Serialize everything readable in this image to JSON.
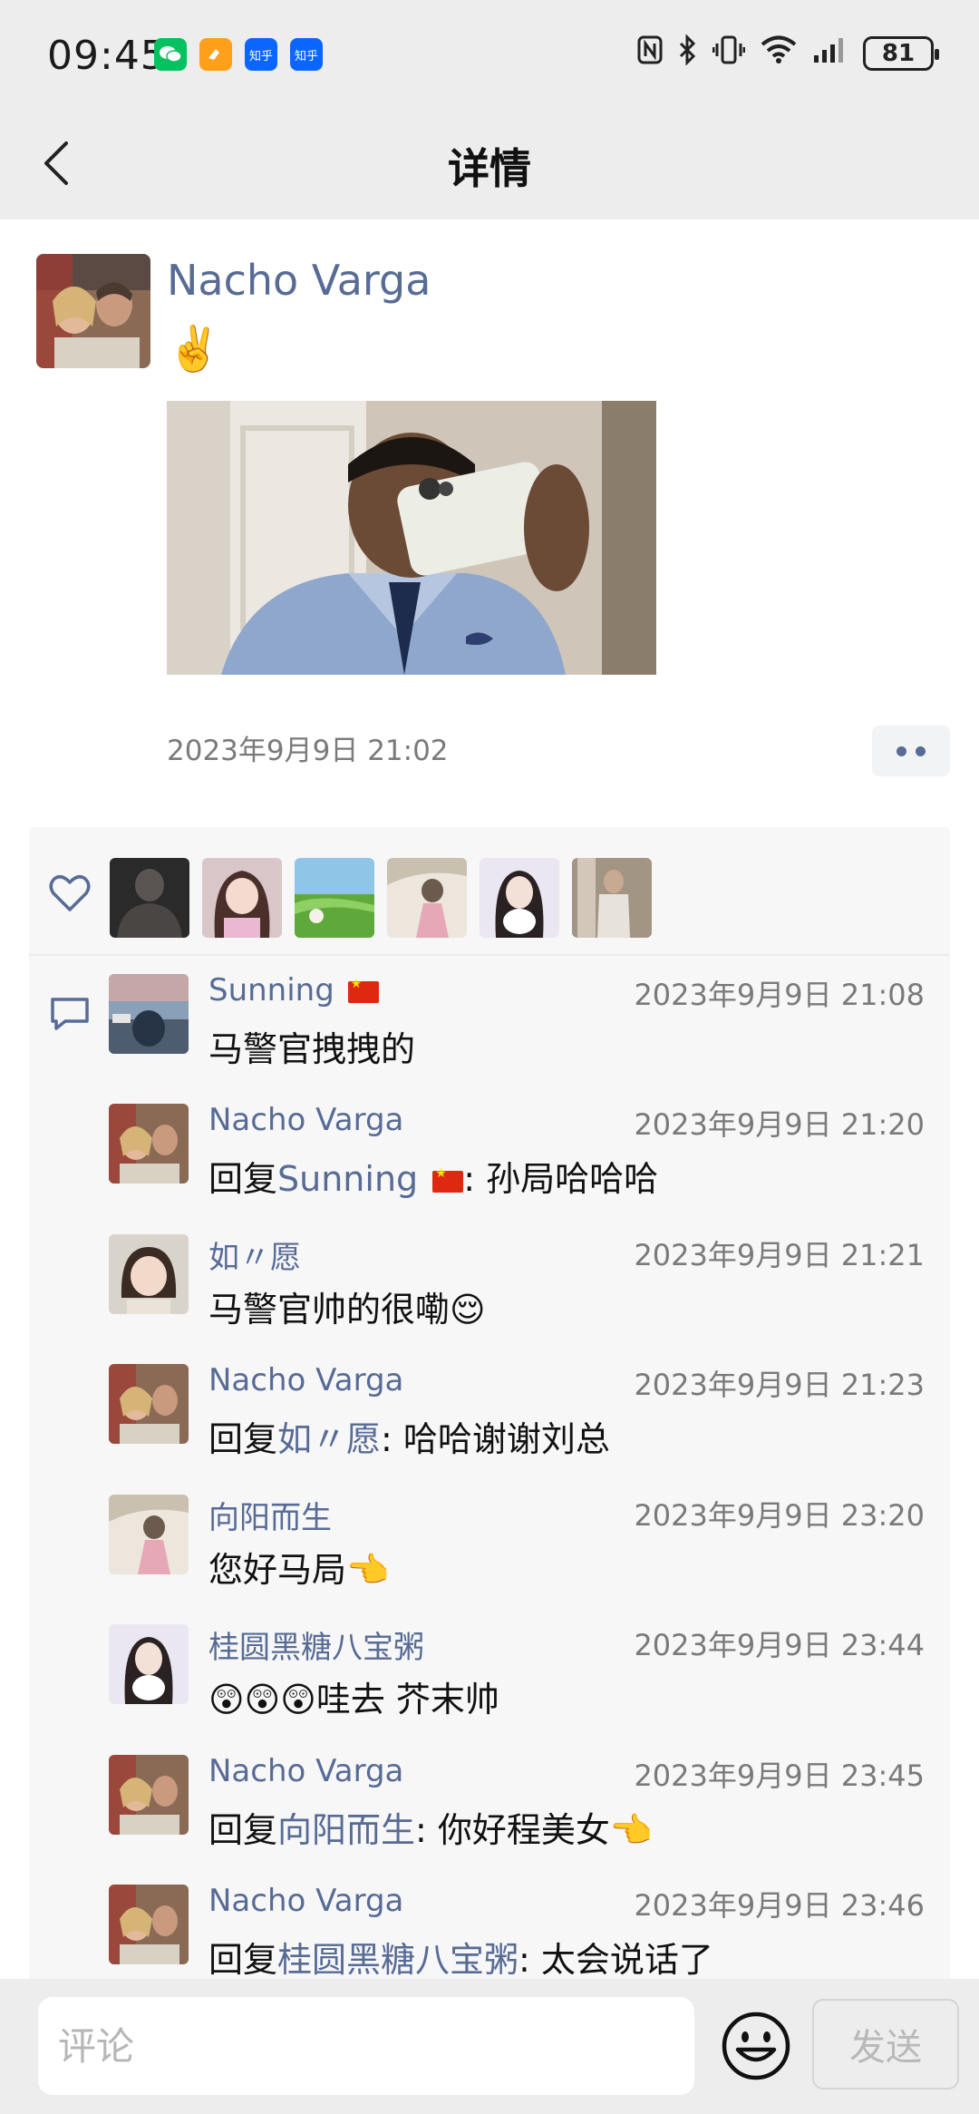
{
  "status_bar": {
    "time": "09:45",
    "apps": [
      "wechat",
      "orange-app",
      "知乎",
      "知乎"
    ],
    "battery": "81"
  },
  "nav": {
    "title": "详情",
    "back_icon": "chevron-left-icon"
  },
  "post": {
    "author": "Nacho Varga",
    "text": "✌️",
    "time": "2023年9月9日 21:02"
  },
  "likes": {
    "icon": "heart-icon",
    "count_avatars": 6
  },
  "comments": [
    {
      "name": "Sunning 🇨🇳",
      "time": "2023年9月9日 21:08",
      "prefix": "",
      "reply_to": "",
      "text": "马警官拽拽的"
    },
    {
      "name": "Nacho Varga",
      "time": "2023年9月9日 21:20",
      "prefix": "回复",
      "reply_to": "Sunning 🇨🇳",
      "text": ": 孙局哈哈哈"
    },
    {
      "name": "如〃愿",
      "time": "2023年9月9日 21:21",
      "prefix": "",
      "reply_to": "",
      "text": "马警官帅的很嘞😌"
    },
    {
      "name": "Nacho Varga",
      "time": "2023年9月9日 21:23",
      "prefix": "回复",
      "reply_to": "如〃愿",
      "text": ": 哈哈谢谢刘总"
    },
    {
      "name": "向阳而生",
      "time": "2023年9月9日 23:20",
      "prefix": "",
      "reply_to": "",
      "text": "您好马局👈"
    },
    {
      "name": "桂圆黑糖八宝粥",
      "time": "2023年9月9日 23:44",
      "prefix": "",
      "reply_to": "",
      "text": "😲😲😲哇去 芥末帅"
    },
    {
      "name": "Nacho Varga",
      "time": "2023年9月9日 23:45",
      "prefix": "回复",
      "reply_to": "向阳而生",
      "text": ": 你好程美女👈"
    },
    {
      "name": "Nacho Varga",
      "time": "2023年9月9日 23:46",
      "prefix": "回复",
      "reply_to": "桂圆黑糖八宝粥",
      "text": ": 太会说话了"
    }
  ],
  "bottom": {
    "placeholder": "评论",
    "send_label": "发送"
  }
}
